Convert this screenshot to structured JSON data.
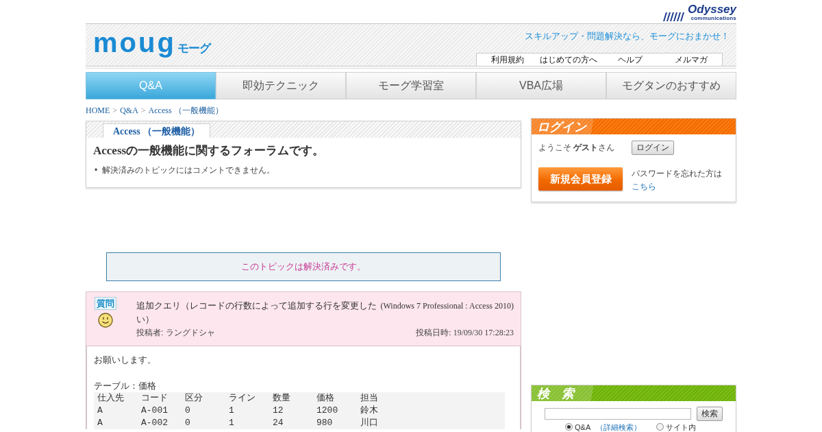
{
  "header": {
    "partner_logo": {
      "name": "Odyssey",
      "tagline": "communications"
    },
    "logo": {
      "wordmark": "moug",
      "kana": "モーグ"
    },
    "catchphrase": "スキルアップ・問題解決なら、モーグにおまかせ！",
    "utility_links": [
      "利用規約",
      "はじめての方へ",
      "ヘルプ",
      "メルマガ"
    ]
  },
  "nav_tabs": [
    {
      "label": "Q&A",
      "selected": true
    },
    {
      "label": "即効テクニック",
      "selected": false
    },
    {
      "label": "モーグ学習室",
      "selected": false
    },
    {
      "label": "VBA広場",
      "selected": false
    },
    {
      "label": "モグタンのおすすめ",
      "selected": false
    }
  ],
  "breadcrumb": {
    "items": [
      "HOME",
      "Q&A",
      "Access （一般機能）"
    ],
    "separator": ">"
  },
  "forum": {
    "tab": "Access （一般機能）",
    "heading": "Accessの一般機能に関するフォーラムです。",
    "notes": [
      {
        "marker": "•",
        "text": "解決済みのトピックにはコメントできません。"
      }
    ]
  },
  "resolved_notice": "このトピックは解決済みです。",
  "topic": {
    "badge": "質問",
    "title": "追加クエリ（レコードの行数によって追加する行を変更したい）",
    "environment": "(Windows 7 Professional : Access 2010)",
    "author": "投稿者: ラングドシャ",
    "posted": "投稿日時: 19/09/30 17:28:23",
    "paragraphs": [
      "お願いします。",
      "テーブル：価格"
    ],
    "code_rows": [
      [
        "仕入先",
        "コード",
        "区分",
        "ライン",
        "数量",
        "価格",
        "担当"
      ],
      [
        "A",
        "A-001",
        "0",
        "1",
        "12",
        "1200",
        "鈴木"
      ],
      [
        "A",
        "A-002",
        "0",
        "1",
        "24",
        "980",
        "川口"
      ]
    ]
  },
  "login": {
    "title": "ログイン",
    "welcome": "ようこそ **ゲスト**さん",
    "login_button": "ログイン",
    "register_button": "新規会員登録",
    "forgot_text": "パスワードを忘れた方は",
    "forgot_link": "こちら"
  },
  "search": {
    "title": "検　索",
    "button": "検索",
    "scopes": [
      {
        "label": "Q&A",
        "selected": true
      },
      {
        "label": "サイト内",
        "selected": false
      }
    ],
    "advanced_link": "（詳細検索）"
  }
}
